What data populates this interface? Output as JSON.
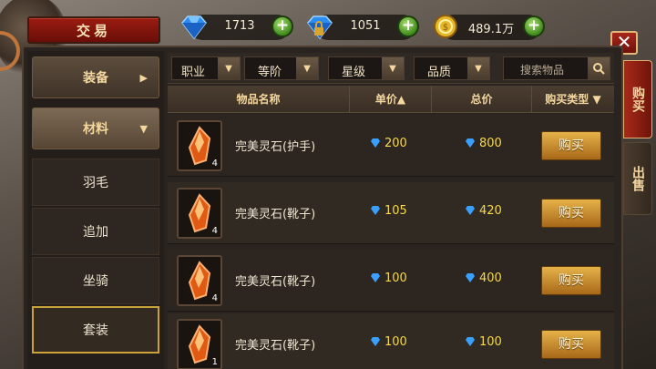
{
  "title": "交易",
  "currency": [
    {
      "icon": "blue-diamond-icon",
      "value": "1713"
    },
    {
      "icon": "locked-diamond-icon",
      "value": "1051"
    },
    {
      "icon": "gold-coin-icon",
      "value": "489.1万"
    }
  ],
  "close_label": "✕",
  "categories": {
    "equipment": "装备",
    "materials": "材料",
    "subitems": [
      "羽毛",
      "追加",
      "坐骑",
      "套装"
    ]
  },
  "filters": {
    "profession": "职业",
    "rank": "等阶",
    "star": "星级",
    "quality": "品质",
    "search_placeholder": "搜索物品"
  },
  "columns": {
    "name": "物品名称",
    "unit_price": "单价▲",
    "total_price": "总价",
    "buy_type": "购买类型 ▼"
  },
  "rows": [
    {
      "name": "完美灵石(护手)",
      "qty": "4",
      "unit": "200",
      "total": "800",
      "buy": "购买"
    },
    {
      "name": "完美灵石(靴子)",
      "qty": "4",
      "unit": "105",
      "total": "420",
      "buy": "购买"
    },
    {
      "name": "完美灵石(靴子)",
      "qty": "4",
      "unit": "100",
      "total": "400",
      "buy": "购买"
    },
    {
      "name": "完美灵石(靴子)",
      "qty": "1",
      "unit": "100",
      "total": "100",
      "buy": "购买"
    }
  ],
  "side_tabs": {
    "buy": "购买",
    "sell": "出售"
  },
  "colors": {
    "accent_red": "#9a1c12",
    "gold": "#f3d79f",
    "diamond_blue": "#3aa0ff"
  }
}
